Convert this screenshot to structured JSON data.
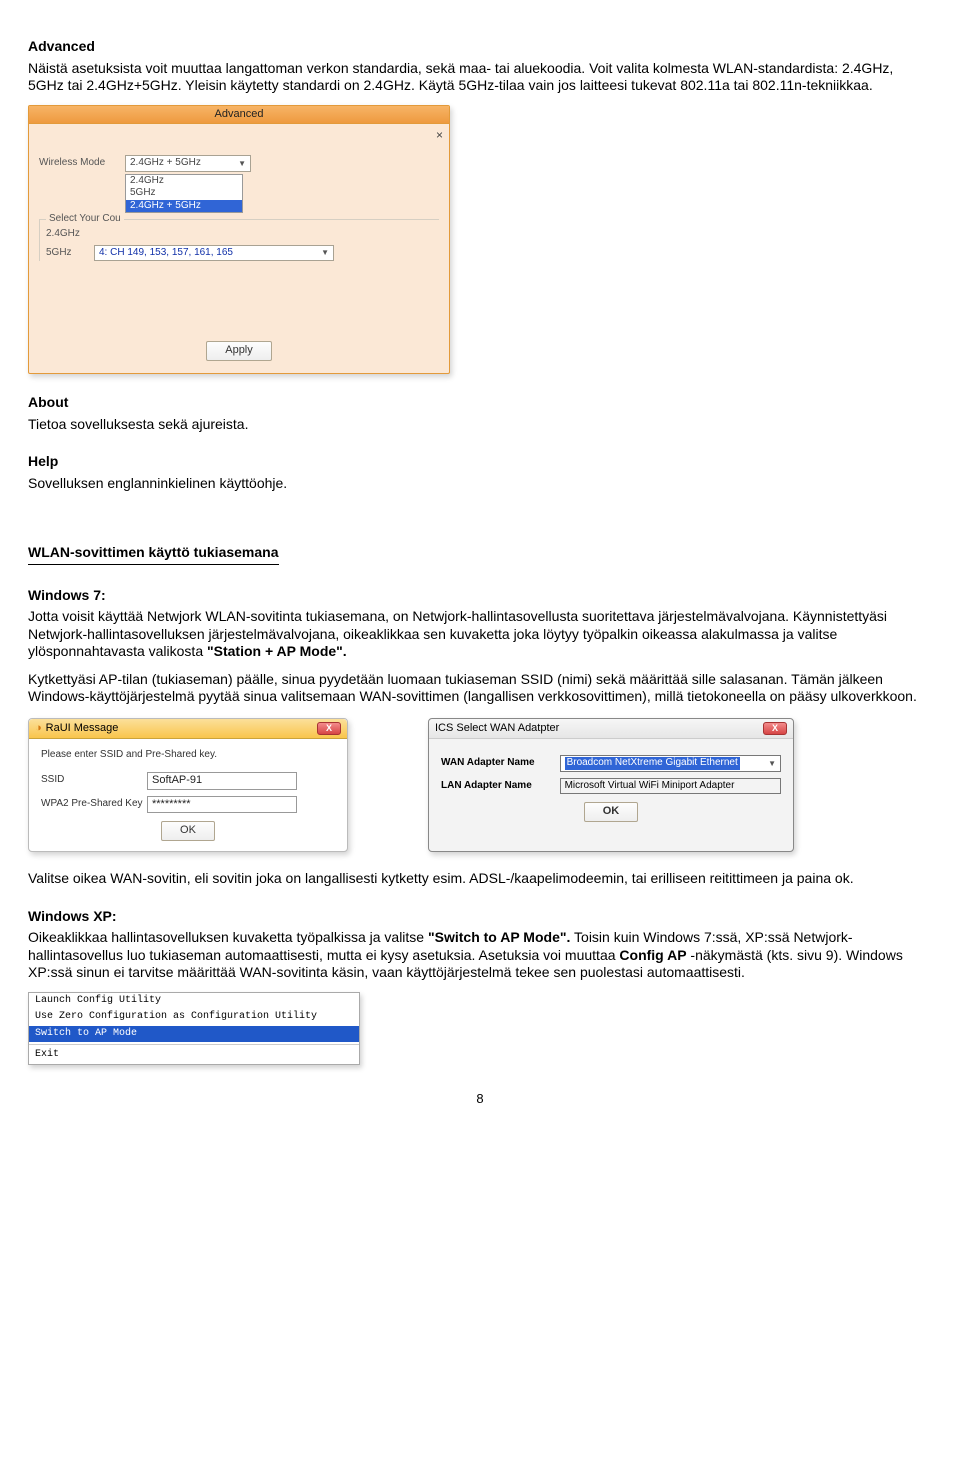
{
  "advanced": {
    "title": "Advanced",
    "desc": "Näistä asetuksista voit muuttaa langattoman verkon standardia, sekä maa- tai aluekoodia. Voit valita kolmesta WLAN-standardista: 2.4GHz, 5GHz tai 2.4GHz+5GHz. Yleisin käytetty standardi on 2.4GHz. Käytä 5GHz-tilaa vain jos laitteesi tukevat 802.11a tai 802.11n-tekniikkaa."
  },
  "adv_dialog": {
    "title": "Advanced",
    "wireless_mode_label": "Wireless Mode",
    "wireless_mode_value": "2.4GHz + 5GHz",
    "options": {
      "a": "2.4GHz",
      "b": "5GHz",
      "c": "2.4GHz + 5GHz"
    },
    "fieldset_legend": "Select Your Cou",
    "label_24": "2.4GHz",
    "label_5": "5GHz",
    "ch_value": "4: CH 149, 153, 157, 161, 165",
    "apply": "Apply",
    "close": "×"
  },
  "about": {
    "title": "About",
    "desc": "Tietoa sovelluksesta sekä ajureista."
  },
  "help": {
    "title": "Help",
    "desc": "Sovelluksen englanninkielinen käyttöohje."
  },
  "wlan_ap": {
    "heading": "WLAN-sovittimen käyttö tukiasemana"
  },
  "win7": {
    "title": "Windows 7:",
    "p1": "Jotta voisit käyttää Netwjork WLAN-sovitinta tukiasemana, on Netwjork-hallintasovellusta suoritettava järjestelmävalvojana. Käynnistettyäsi Netwjork-hallintasovelluksen järjestelmävalvojana, oikeaklikkaa sen kuvaketta joka löytyy työpalkin oikeassa alakulmassa ja valitse ylösponnahtavasta valikosta ",
    "p1_bold": "\"Station + AP Mode\".",
    "p2": "Kytkettyäsi AP-tilan (tukiaseman) päälle, sinua pyydetään luomaan tukiaseman SSID (nimi) sekä määrittää sille salasanan. Tämän jälkeen Windows-käyttöjärjestelmä pyytää sinua valitsemaan WAN-sovittimen (langallisen verkkosovittimen), millä tietokoneella on pääsy ulkoverkkoon."
  },
  "raui": {
    "title": "RaUI Message",
    "msg": "Please enter SSID and Pre-Shared key.",
    "ssid_label": "SSID",
    "ssid_value": "SoftAP-91",
    "wpa_label": "WPA2 Pre-Shared Key",
    "wpa_value": "*********",
    "ok": "OK"
  },
  "ics": {
    "title": "ICS Select WAN Adatpter",
    "wan_label": "WAN Adapter Name",
    "wan_value": "Broadcom NetXtreme Gigabit Ethernet",
    "lan_label": "LAN Adapter Name",
    "lan_value": "Microsoft Virtual WiFi Miniport Adapter",
    "ok": "OK"
  },
  "post_dialog_para": "Valitse oikea WAN-sovitin, eli sovitin joka on langallisesti kytketty esim. ADSL-/kaapelimodeemin, tai erilliseen reitittimeen ja paina ok.",
  "winxp": {
    "title": "Windows XP:",
    "p_a": "Oikeaklikkaa hallintasovelluksen kuvaketta työpalkissa ja valitse ",
    "p_bold1": "\"Switch to AP Mode\".",
    "p_b": " Toisin kuin Windows 7:ssä, XP:ssä Netwjork-hallintasovellus luo tukiaseman automaattisesti, mutta ei kysy asetuksia. Asetuksia voi muuttaa ",
    "p_bold2": "Config AP",
    "p_c": " -näkymästä (kts. sivu 9). Windows XP:ssä sinun ei tarvitse määrittää WAN-sovitinta käsin, vaan käyttöjärjestelmä tekee sen puolestasi automaattisesti."
  },
  "xp_menu": {
    "a": "Launch Config Utility",
    "b": "Use Zero Configuration as Configuration Utility",
    "c": "Switch to AP Mode",
    "d": "Exit"
  },
  "pagenum": "8"
}
